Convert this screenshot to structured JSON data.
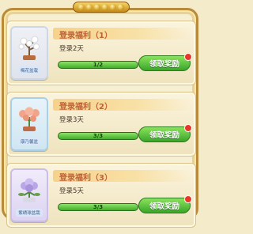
{
  "rewards": [
    {
      "title": "登录福利（1）",
      "subtitle": "登录2天",
      "progress_text": "1/2",
      "progress": 1.0,
      "button": "领取奖励",
      "card_label": "梅花盆栽",
      "card_theme": "c1"
    },
    {
      "title": "登录福利（2）",
      "subtitle": "登录3天",
      "progress_text": "3/3",
      "progress": 1.0,
      "button": "领取奖励",
      "card_label": "康乃馨盆",
      "card_theme": "c2"
    },
    {
      "title": "登录福利（3）",
      "subtitle": "登录5天",
      "progress_text": "3/3",
      "progress": 1.0,
      "button": "领取奖励",
      "card_label": "紫绣球盆栽",
      "card_theme": "c3"
    }
  ],
  "colors": {
    "title": "#c0603a",
    "button_green": "#3aa52a",
    "badge_red": "#e8362a"
  }
}
